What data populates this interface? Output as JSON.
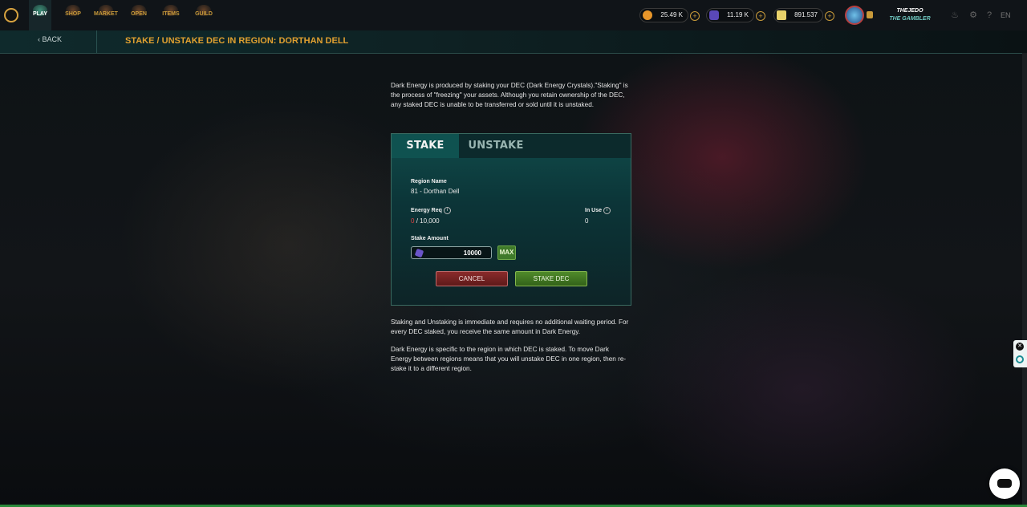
{
  "nav": {
    "logo_text": "SPLINTERLANDS",
    "items": [
      {
        "label": "PLAY",
        "active": true
      },
      {
        "label": "SHOP",
        "active": false
      },
      {
        "label": "MARKET",
        "active": false
      },
      {
        "label": "OPEN",
        "active": false
      },
      {
        "label": "ITEMS",
        "active": false
      },
      {
        "label": "GUILD",
        "active": false
      }
    ]
  },
  "balances": {
    "credits": "25.49 K",
    "dec": "11.19 K",
    "sps": "891.537"
  },
  "user": {
    "name": "THEJEDO",
    "title": "THE GAMBLER"
  },
  "language": "EN",
  "header": {
    "back_label": "BACK",
    "title": "STAKE / UNSTAKE DEC IN REGION: DORTHAN DELL"
  },
  "intro_text": "Dark Energy is produced by staking your DEC (Dark Energy Crystals).\"Staking\" is the process of \"freezing\" your assets. Although you retain ownership of the DEC, any staked DEC is unable to be transferred or sold until it is unstaked.",
  "panel": {
    "tabs": [
      {
        "label": "STAKE",
        "active": true
      },
      {
        "label": "UNSTAKE",
        "active": false
      }
    ],
    "region_label": "Region Name",
    "region_value": "81 - Dorthan Dell",
    "energy_req_label": "Energy Req",
    "energy_req_current": "0",
    "energy_req_total": "/ 10,000",
    "in_use_label": "In Use",
    "in_use_value": "0",
    "stake_amount_label": "Stake Amount",
    "stake_amount_value": "10000",
    "max_label": "MAX",
    "cancel_label": "CANCEL",
    "stake_label": "STAKE DEC"
  },
  "notes": [
    "Staking and Unstaking is immediate and requires no additional waiting period. For every DEC staked, you receive the same amount in Dark Energy.",
    "Dark Energy is specific to the region in which DEC is staked. To move Dark Energy between regions means that you will unstake DEC in one region, then re-stake it to a different region."
  ],
  "colors": {
    "accent_gold": "#e0a030",
    "panel_teal": "#0f4b4a",
    "cancel_red": "#8a2a2a",
    "stake_green": "#4f8a2a"
  }
}
